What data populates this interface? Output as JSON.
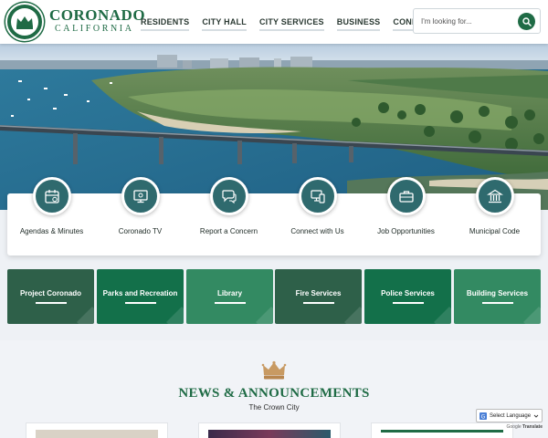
{
  "brand": {
    "name": "CORONADO",
    "subtitle": "CALIFORNIA",
    "seal_text": "CITY OF CORONADO"
  },
  "nav": {
    "items": [
      "RESIDENTS",
      "CITY HALL",
      "CITY SERVICES",
      "BUSINESS",
      "CONNECT"
    ]
  },
  "search": {
    "placeholder": "I'm looking for...",
    "icon": "search-icon"
  },
  "quick_links": [
    {
      "label": "Agendas & Minutes",
      "icon": "calendar-icon"
    },
    {
      "label": "Coronado TV",
      "icon": "monitor-icon"
    },
    {
      "label": "Report a Concern",
      "icon": "chat-bubble-icon"
    },
    {
      "label": "Connect with Us",
      "icon": "devices-icon"
    },
    {
      "label": "Job Opportunities",
      "icon": "briefcase-icon"
    },
    {
      "label": "Municipal Code",
      "icon": "courthouse-icon"
    }
  ],
  "tiles": [
    {
      "label": "Project Coronado",
      "color": "#2e6049"
    },
    {
      "label": "Parks and Recreation",
      "color": "#13704a"
    },
    {
      "label": "Library",
      "color": "#338a62"
    },
    {
      "label": "Fire Services",
      "color": "#2e6049"
    },
    {
      "label": "Police Services",
      "color": "#13704a"
    },
    {
      "label": "Building Services",
      "color": "#338a62"
    }
  ],
  "news": {
    "title": "NEWS & ANNOUNCEMENTS",
    "subtitle": "The Crown City"
  },
  "translate": {
    "label": "Select Language",
    "powered_by": "Google",
    "powered_suffix": "Translate"
  },
  "colors": {
    "brand_green": "#1f6b45",
    "icon_teal": "#2f6a6e",
    "crown_gold": "#c89a63"
  }
}
